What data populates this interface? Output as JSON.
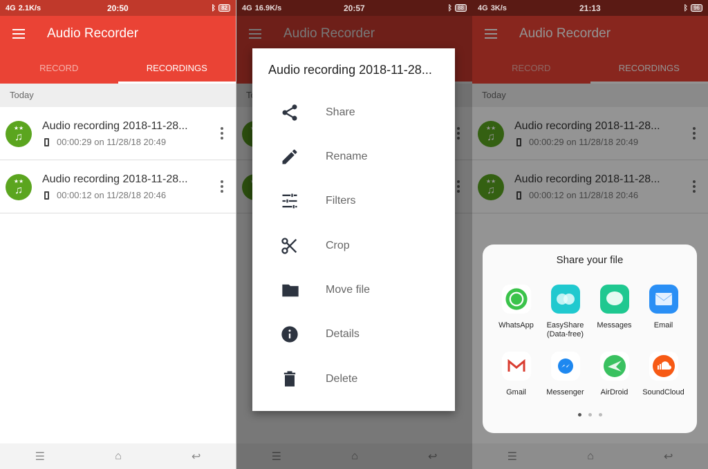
{
  "app_title": "Audio Recorder",
  "tabs": [
    "RECORD",
    "RECORDINGS"
  ],
  "section": "Today",
  "recordings": [
    {
      "title": "Audio recording 2018-11-28...",
      "meta": "00:00:29 on 11/28/18 20:49"
    },
    {
      "title": "Audio recording 2018-11-28...",
      "meta": "00:00:12 on 11/28/18 20:46"
    }
  ],
  "status": [
    {
      "speed": "2.1K/s",
      "time": "20:50",
      "battery": "82",
      "net": "4G"
    },
    {
      "speed": "16.9K/s",
      "time": "20:57",
      "battery": "88",
      "net": "4G"
    },
    {
      "speed": "3K/s",
      "time": "21:13",
      "battery": "96",
      "net": "4G"
    }
  ],
  "context_menu": {
    "title": "Audio recording 2018-11-28...",
    "items": [
      "Share",
      "Rename",
      "Filters",
      "Crop",
      "Move file",
      "Details",
      "Delete"
    ]
  },
  "share_sheet": {
    "title": "Share your file",
    "apps": [
      "WhatsApp",
      "EasyShare\n(Data-free)",
      "Messages",
      "Email",
      "Gmail",
      "Messenger",
      "AirDroid",
      "SoundCloud"
    ],
    "page": 1,
    "pages": 3
  },
  "colors": {
    "primary": "#ea4335",
    "avatar": "#5ba51f"
  }
}
